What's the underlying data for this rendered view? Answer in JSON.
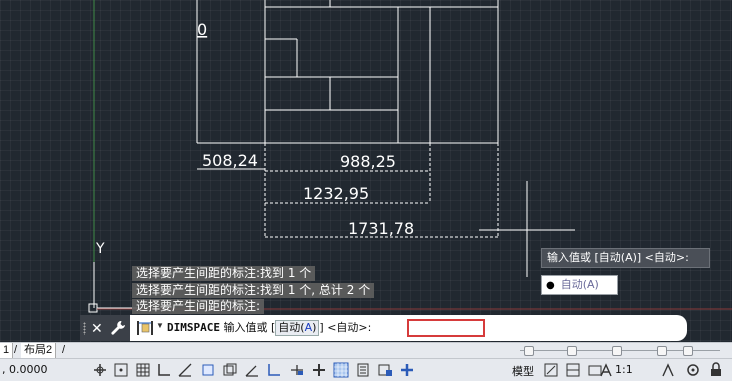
{
  "drawing": {
    "dimensions": [
      "0",
      "508,24",
      "988,25",
      "1232,95",
      "1731,78"
    ],
    "ucs_label": "Y"
  },
  "history": [
    "选择要产生间距的标注:找到 1 个",
    "选择要产生间距的标注:找到 1 个, 总计 2 个",
    "选择要产生间距的标注:"
  ],
  "tooltip": {
    "prompt": "输入值或 [自动(A)] <自动>:",
    "option": "自动(A)"
  },
  "command": {
    "name": "DIMSPACE",
    "prompt_prefix": "输入值或",
    "option_open": "[",
    "option_label": "自动(",
    "option_key": "A",
    "option_close": ")",
    "option_end": "]",
    "default": "<自动>:",
    "input_value": ""
  },
  "tabs": {
    "layout1_fragment": "1",
    "layout2": "布局2"
  },
  "status": {
    "coords": ", 0.0000",
    "model": "模型",
    "scale": "1:1"
  },
  "icons": {
    "close": "close-icon",
    "customize": "wrench-icon",
    "command": "dimension-icon"
  }
}
